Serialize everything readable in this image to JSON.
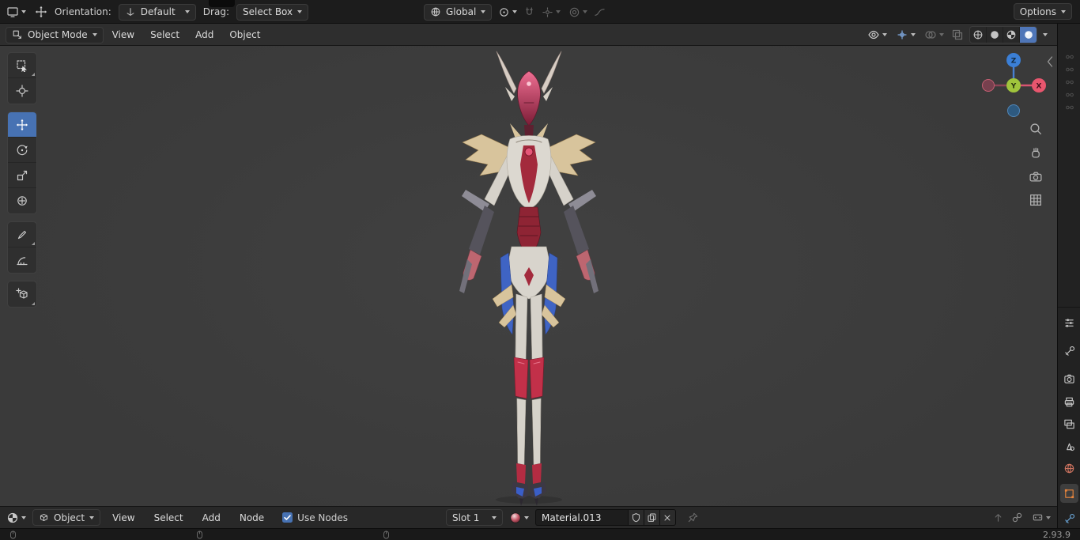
{
  "colors": {
    "accent": "#4772b3",
    "axis_x": "#e8566e",
    "axis_y": "#a0c43c",
    "axis_z": "#3b7fd6",
    "viewport_bg": "#3b3b3b",
    "topbar_bg": "#1c1c1c",
    "header_bg": "#2e2e2e"
  },
  "topbar": {
    "orientation_label": "Orientation:",
    "orientation_value": "Default",
    "drag_label": "Drag:",
    "drag_value": "Select Box",
    "transform_orientation": "Global",
    "options_label": "Options"
  },
  "viewport_header": {
    "mode": "Object Mode",
    "menus": [
      "View",
      "Select",
      "Add",
      "Object"
    ],
    "shading_modes": [
      "wireframe",
      "solid",
      "material-preview",
      "rendered"
    ],
    "active_shading": "rendered"
  },
  "tool_shelf": {
    "tools": [
      "select-box",
      "cursor",
      "move",
      "rotate",
      "scale",
      "transform",
      "annotate",
      "measure",
      "add-cube"
    ],
    "active_tool": "move"
  },
  "gizmo": {
    "x": "X",
    "y": "Y",
    "z": "Z"
  },
  "shader_editor": {
    "object_value": "Object",
    "menus": [
      "View",
      "Select",
      "Add",
      "Node"
    ],
    "use_nodes_label": "Use Nodes",
    "slot_value": "Slot 1",
    "material_name": "Material.013"
  },
  "status_bar": {
    "version": "2.93.9"
  },
  "icons": {
    "topbar": [
      "editor-type-icon",
      "move-tool-icon",
      "orientation-axis-icon",
      "pivot-icon",
      "snap-magnet-icon",
      "snap-target-icon",
      "proportional-editing-icon",
      "falloff-curve-icon"
    ],
    "viewport_nav": [
      "zoom-icon",
      "hand-icon",
      "camera-icon",
      "grid-icon"
    ],
    "properties_tabs": [
      "editor-type-icon",
      "tool-icon",
      "render-icon",
      "output-icon",
      "view-layer-icon",
      "scene-icon",
      "world-icon",
      "object-icon",
      "modifier-icon"
    ],
    "material_row": [
      "shader-editor-icon",
      "object-cube-icon",
      "material-ball-icon",
      "fake-user-shield-icon",
      "duplicate-icon",
      "unlink-x-icon",
      "pin-icon"
    ]
  }
}
